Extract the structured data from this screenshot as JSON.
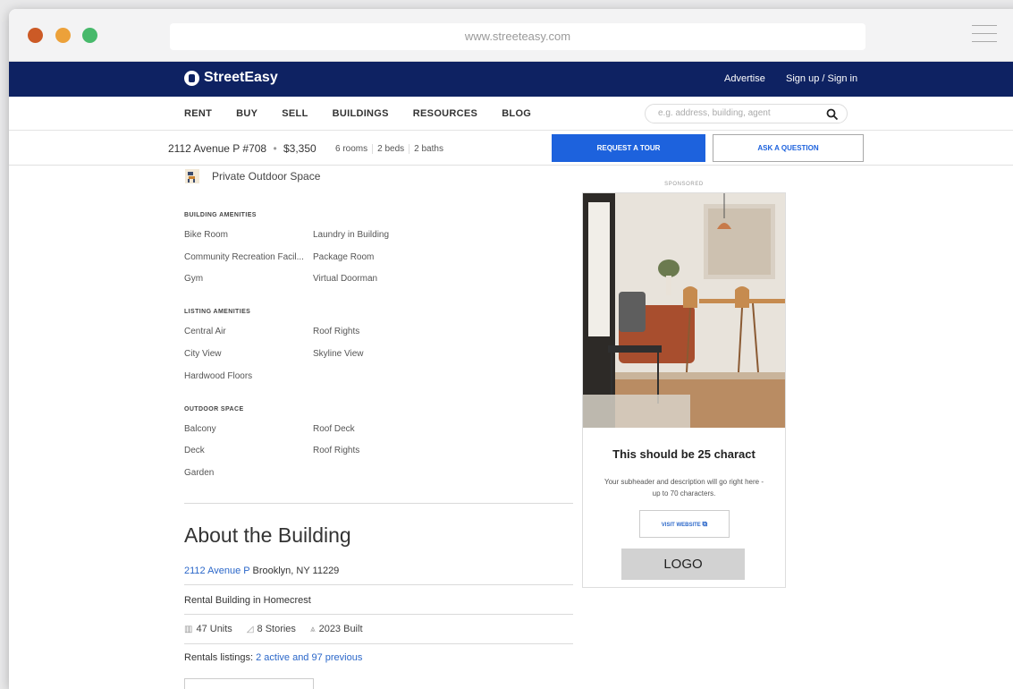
{
  "browser": {
    "url": "www.streeteasy.com"
  },
  "site": {
    "brand": "StreetEasy",
    "top_links": {
      "advertise": "Advertise",
      "signin": "Sign up / Sign in"
    },
    "menu": [
      "RENT",
      "BUY",
      "SELL",
      "BUILDINGS",
      "RESOURCES",
      "BLOG"
    ],
    "search_placeholder": "e.g. address, building, agent"
  },
  "listing_bar": {
    "address": "2112 Avenue P #708",
    "price": "$3,350",
    "rooms": "6 rooms",
    "beds": "2 beds",
    "baths": "2 baths",
    "tour_button": "REQUEST A TOUR",
    "ask_button": "ASK A QUESTION"
  },
  "amenities": {
    "private_outdoor": "Private Outdoor Space",
    "building": {
      "title": "BUILDING AMENITIES",
      "left": [
        "Bike Room",
        "Community Recreation Facil...",
        "Gym"
      ],
      "right": [
        "Laundry in Building",
        "Package Room",
        "Virtual Doorman"
      ]
    },
    "listing": {
      "title": "LISTING AMENITIES",
      "left": [
        "Central Air",
        "City View",
        "Hardwood Floors"
      ],
      "right": [
        "Roof Rights",
        "Skyline View"
      ]
    },
    "outdoor": {
      "title": "OUTDOOR SPACE",
      "left": [
        "Balcony",
        "Deck",
        "Garden"
      ],
      "right": [
        "Roof Deck",
        "Roof Rights"
      ]
    }
  },
  "about": {
    "title": "About the Building",
    "street_link": "2112 Avenue P",
    "city": "Brooklyn, NY 11229",
    "type": "Rental Building in Homecrest",
    "units": "47 Units",
    "stories": "8 Stories",
    "built": "2023 Built",
    "rentals_label": "Rentals listings:",
    "rentals_link": "2 active and 97 previous"
  },
  "ad": {
    "sponsored": "SPONSORED",
    "headline": "This should be 25 charact",
    "subheader": "Your subheader and description will go right here - up to 70 characters.",
    "button": "VISIT WEBSITE",
    "logo": "LOGO"
  }
}
